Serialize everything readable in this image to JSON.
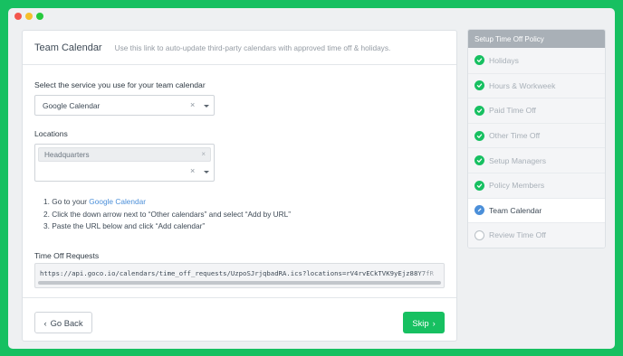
{
  "window": {
    "controls": [
      "close",
      "minimize",
      "maximize"
    ]
  },
  "card": {
    "title": "Team Calendar",
    "subtitle": "Use this link to auto-update third-party calendars with approved time off & holidays."
  },
  "service": {
    "label": "Select the service you use for your team calendar",
    "value": "Google Calendar",
    "clear": "×"
  },
  "locations": {
    "label": "Locations",
    "tags": [
      "Headquarters"
    ],
    "tag_remove": "×",
    "clear": "×"
  },
  "steps": {
    "items": [
      {
        "number": "1.",
        "prefix": "Go to your ",
        "link": "Google Calendar",
        "suffix": ""
      },
      {
        "number": "2.",
        "prefix": "Click the down arrow next to “Other calendars” and select “Add by URL”",
        "link": "",
        "suffix": ""
      },
      {
        "number": "3.",
        "prefix": "Paste the URL below and click “Add calendar”",
        "link": "",
        "suffix": ""
      }
    ]
  },
  "time_off": {
    "label": "Time Off Requests",
    "url": "https://api.goco.io/calendars/time_off_requests/UzpoSJrjqbadRA.ics?locations=rV4rvECkTVK9yEjz88Y7fR"
  },
  "footer": {
    "back_label": "Go Back",
    "back_icon": "‹",
    "skip_label": "Skip",
    "skip_icon": "›"
  },
  "sidebar": {
    "header": "Setup Time Off Policy",
    "items": [
      {
        "label": "Holidays",
        "status": "done"
      },
      {
        "label": "Hours & Workweek",
        "status": "done"
      },
      {
        "label": "Paid Time Off",
        "status": "done"
      },
      {
        "label": "Other Time Off",
        "status": "done"
      },
      {
        "label": "Setup Managers",
        "status": "done"
      },
      {
        "label": "Policy Members",
        "status": "done"
      },
      {
        "label": "Team Calendar",
        "status": "current"
      },
      {
        "label": "Review Time Off",
        "status": "todo"
      }
    ]
  },
  "colors": {
    "brand": "#17c061",
    "link": "#4b8fd9",
    "sidebar_header": "#a9b0b7"
  }
}
